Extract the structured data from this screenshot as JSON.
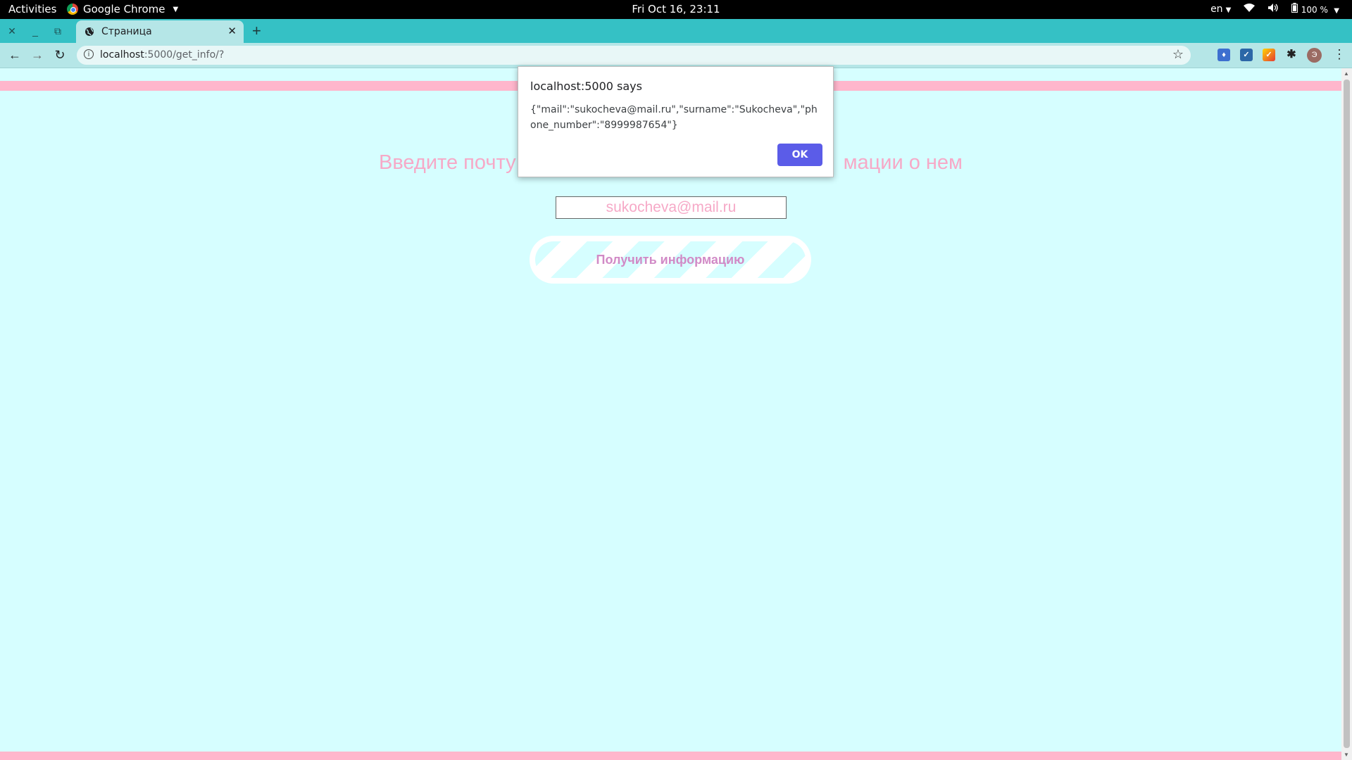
{
  "system_bar": {
    "activities": "Activities",
    "app_name": "Google Chrome",
    "clock": "Fri Oct 16, 23:11",
    "language": "en",
    "battery": "100 %"
  },
  "browser": {
    "tab_title": "Страница",
    "url_host": "localhost",
    "url_rest": ":5000/get_info/?",
    "avatar_letter": "Э"
  },
  "page": {
    "heading_left": "Введите почту",
    "heading_right": "мации о нем",
    "email_value": "sukocheva@mail.ru",
    "button_label": "Получить информацию"
  },
  "dialog": {
    "title": "localhost:5000 says",
    "message": "{\"mail\":\"sukocheva@mail.ru\",\"surname\":\"Sukocheva\",\"phone_number\":\"8999987654\"}",
    "ok_label": "OK"
  },
  "colors": {
    "page_bg": "#d6feff",
    "accent_pink": "#ffb6cc",
    "text_pink": "#f6a9c7",
    "button_text": "#d18ac6",
    "ok_button": "#5b5ce8",
    "tabstrip": "#35c1c5"
  }
}
